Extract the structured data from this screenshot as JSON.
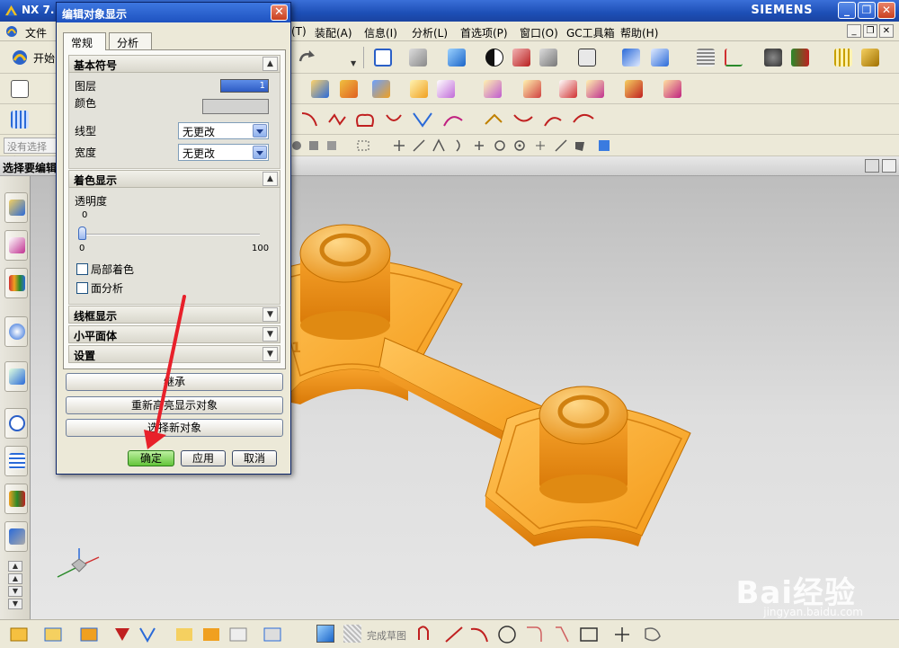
{
  "window": {
    "title": "NX 7.",
    "brand": "SIEMENS",
    "controls": [
      "_",
      "❐",
      "✕"
    ]
  },
  "menubar": {
    "items": [
      "文件",
      "(T)",
      "装配(A)",
      "信息(I)",
      "分析(L)",
      "首选项(P)",
      "窗口(O)",
      "GC工具箱",
      "帮助(H)"
    ],
    "file_label": "文件",
    "mdi_controls": [
      "_",
      "❐",
      "✕"
    ]
  },
  "toolbar": {
    "start_label": "开始"
  },
  "filterbar": {
    "placeholder": "没有选择过"
  },
  "cue": {
    "text": "选择要编辑"
  },
  "dialog": {
    "title": "编辑对象显示",
    "close": "✕",
    "tabs": {
      "general": "常规",
      "analysis": "分析"
    },
    "basic_symbol": {
      "header": "基本符号",
      "layer_label": "图层",
      "layer_value": "1",
      "color_label": "颜色",
      "linetype_label": "线型",
      "linetype_value": "无更改",
      "width_label": "宽度",
      "width_value": "无更改"
    },
    "shading": {
      "header": "着色显示",
      "transparency_label": "透明度",
      "transparency_value": "0",
      "transparency_fraction": 0,
      "slider_min": "0",
      "slider_max": "100",
      "partial_shading_label": "局部着色",
      "face_analysis_label": "面分析"
    },
    "collapsed_groups": [
      "线框显示",
      "小平面体",
      "设置"
    ],
    "actions": {
      "inherit": "继承",
      "re_highlight": "重新高亮显示对象",
      "select_new": "选择新对象"
    },
    "buttons": {
      "ok": "确定",
      "apply": "应用",
      "cancel": "取消"
    }
  },
  "bottom_toolbar": {
    "finish_sketch": "完成草图"
  },
  "watermark": {
    "text": "Bai经验",
    "url": "jingyan.baidu.com"
  },
  "colors": {
    "titlebar": "#1d4fb6",
    "part": "#f6a72c",
    "ok_button": "#63c43a",
    "annotation_arrow": "#e8202a"
  }
}
